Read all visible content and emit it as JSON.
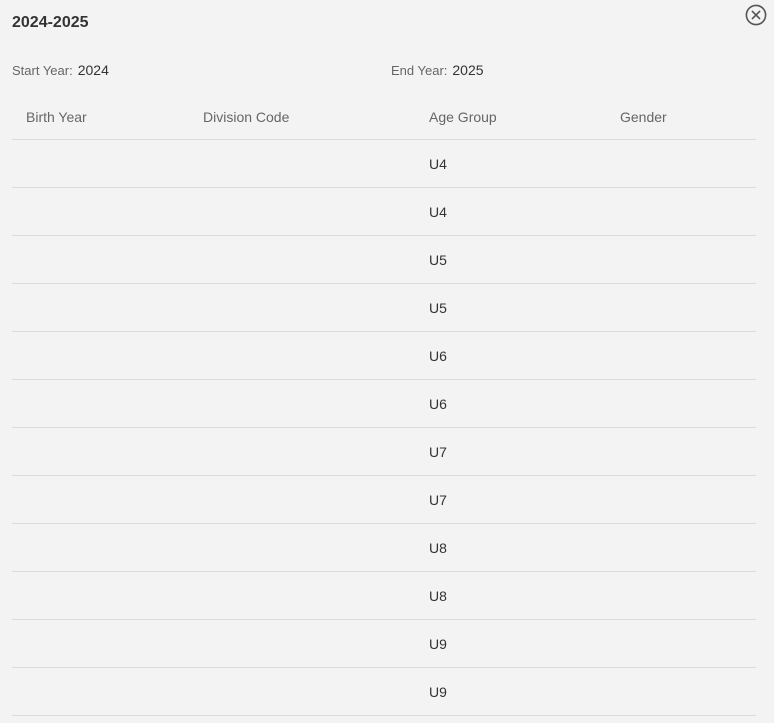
{
  "modal": {
    "title": "2024-2025",
    "close_icon": "close-circle-icon"
  },
  "years": {
    "start_label": "Start Year:",
    "start_value": "2024",
    "end_label": "End Year:",
    "end_value": "2025"
  },
  "table": {
    "columns": [
      "Birth Year",
      "Division Code",
      "Age Group",
      "Gender"
    ],
    "rows": [
      {
        "birth_year": "",
        "division_code": "",
        "age_group": "U4",
        "gender": ""
      },
      {
        "birth_year": "",
        "division_code": "",
        "age_group": "U4",
        "gender": ""
      },
      {
        "birth_year": "",
        "division_code": "",
        "age_group": "U5",
        "gender": ""
      },
      {
        "birth_year": "",
        "division_code": "",
        "age_group": "U5",
        "gender": ""
      },
      {
        "birth_year": "",
        "division_code": "",
        "age_group": "U6",
        "gender": ""
      },
      {
        "birth_year": "",
        "division_code": "",
        "age_group": "U6",
        "gender": ""
      },
      {
        "birth_year": "",
        "division_code": "",
        "age_group": "U7",
        "gender": ""
      },
      {
        "birth_year": "",
        "division_code": "",
        "age_group": "U7",
        "gender": ""
      },
      {
        "birth_year": "",
        "division_code": "",
        "age_group": "U8",
        "gender": ""
      },
      {
        "birth_year": "",
        "division_code": "",
        "age_group": "U8",
        "gender": ""
      },
      {
        "birth_year": "",
        "division_code": "",
        "age_group": "U9",
        "gender": ""
      },
      {
        "birth_year": "",
        "division_code": "",
        "age_group": "U9",
        "gender": ""
      }
    ]
  }
}
